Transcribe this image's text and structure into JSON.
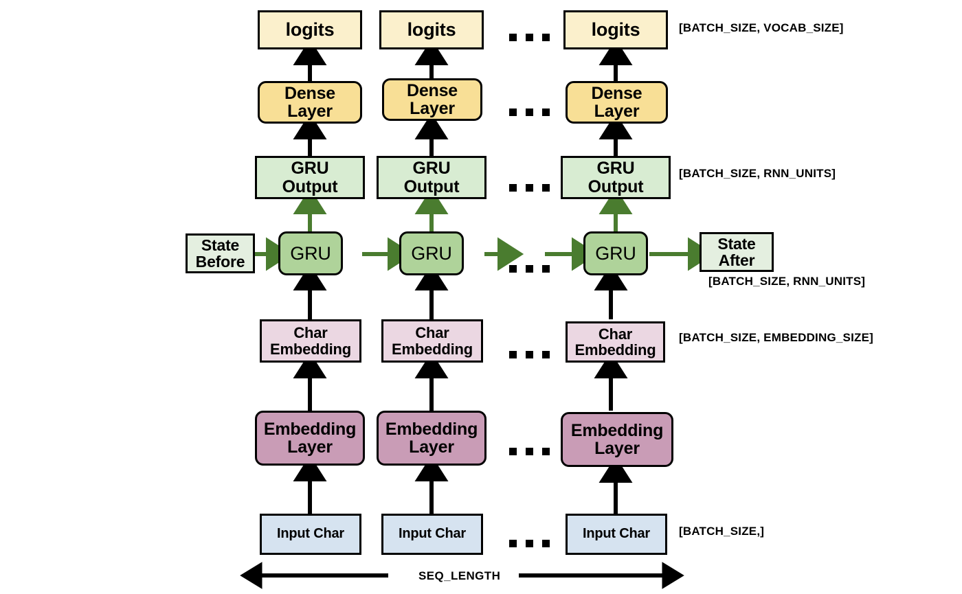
{
  "diagram": {
    "title": "Char-RNN (GRU) unrolled sequence model",
    "colors": {
      "logits": "#FBF0CC",
      "dense": "#F8DF96",
      "gru_output": "#D8ECD2",
      "gru": "#AFD39A",
      "char_embedding": "#EBD7E2",
      "embedding_layer": "#C99CB6",
      "input_char": "#D6E3F0",
      "state": "#E4EFE0",
      "arrow_black": "#000000",
      "arrow_green": "#4A7C2F",
      "border": "#000000"
    },
    "labels": {
      "logits": "logits",
      "dense_layer": "Dense\nLayer",
      "dense_layer_line1": "Dense",
      "dense_layer_line2": "Layer",
      "gru_output_line1": "GRU",
      "gru_output_line2": "Output",
      "gru": "GRU",
      "char_embedding_line1": "Char",
      "char_embedding_line2": "Embedding",
      "embedding_layer_line1": "Embedding",
      "embedding_layer_line2": "Layer",
      "input_char": "Input Char",
      "state_before_line1": "State",
      "state_before_line2": "Before",
      "state_after_line1": "State",
      "state_after_line2": "After",
      "ellipsis": "..."
    },
    "shape_annotations": {
      "logits": "[BATCH_SIZE, VOCAB_SIZE]",
      "gru_output": "[BATCH_SIZE, RNN_UNITS]",
      "state_after": "[BATCH_SIZE, RNN_UNITS]",
      "char_embedding": "[BATCH_SIZE, EMBEDDING_SIZE]",
      "input_char": "[BATCH_SIZE,]"
    },
    "seq_length_label": "SEQ_LENGTH",
    "timesteps": [
      {
        "index": 1,
        "logits": "logits",
        "dense_l1": "Dense",
        "dense_l2": "Layer",
        "gruout_l1": "GRU",
        "gruout_l2": "Output",
        "gru": "GRU",
        "charemb_l1": "Char",
        "charemb_l2": "Embedding",
        "emblayer_l1": "Embedding",
        "emblayer_l2": "Layer",
        "input": "Input Char"
      },
      {
        "index": 2,
        "logits": "logits",
        "dense_l1": "Dense",
        "dense_l2": "Layer",
        "gruout_l1": "GRU",
        "gruout_l2": "Output",
        "gru": "GRU",
        "charemb_l1": "Char",
        "charemb_l2": "Embedding",
        "emblayer_l1": "Embedding",
        "emblayer_l2": "Layer",
        "input": "Input Char"
      },
      {
        "index": 3,
        "logits": "logits",
        "dense_l1": "Dense",
        "dense_l2": "Layer",
        "gruout_l1": "GRU",
        "gruout_l2": "Output",
        "gru": "GRU",
        "charemb_l1": "Char",
        "charemb_l2": "Embedding",
        "emblayer_l1": "Embedding",
        "emblayer_l2": "Layer",
        "input": "Input Char"
      }
    ]
  }
}
